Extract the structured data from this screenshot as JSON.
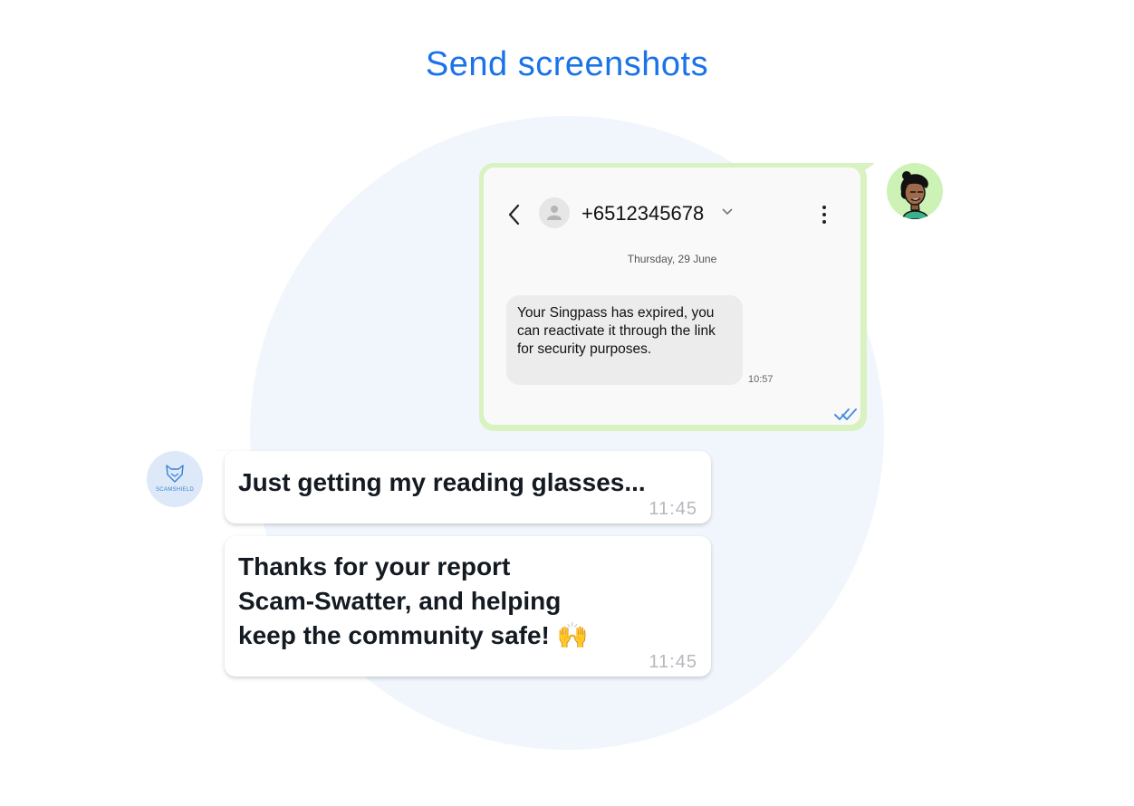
{
  "title": "Send screenshots",
  "screenshot": {
    "phone_number": "+6512345678",
    "date": "Thursday, 29 June",
    "sms_text": "Your Singpass has expired, you can reactivate it through the link for security purposes.",
    "sms_time": "10:57"
  },
  "bot": {
    "brand": "SCAMSHIELD"
  },
  "messages": [
    {
      "text": "Just getting my reading glasses...",
      "time": "11:45"
    },
    {
      "text_line1": "Thanks for your report",
      "text_line2": "Scam-Swatter, and helping",
      "text_line3": "keep the community safe! 🙌",
      "time": "11:45"
    }
  ],
  "colors": {
    "title": "#1a73e8",
    "user_bubble_border": "#d8f2c2",
    "background_circle": "#f1f6fd",
    "read_ticks": "#4a90e2"
  }
}
